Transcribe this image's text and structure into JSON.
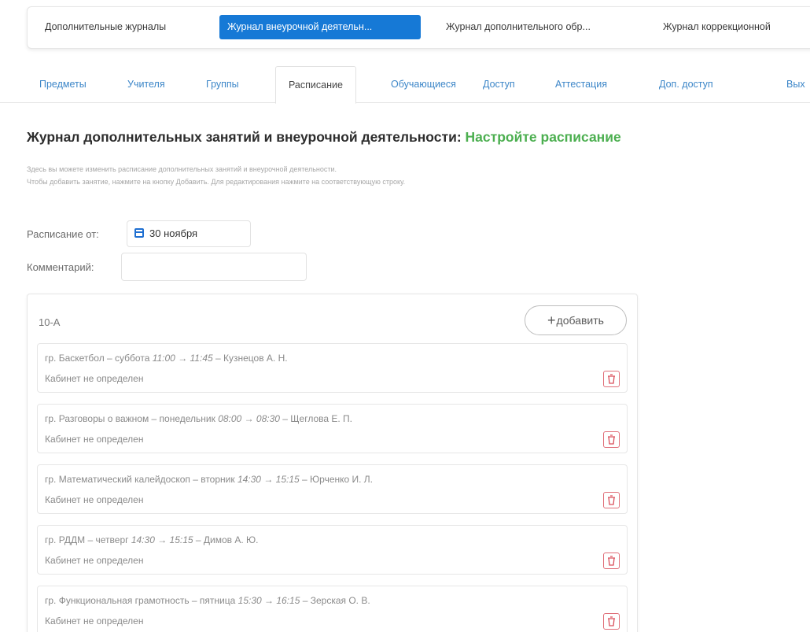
{
  "journals": [
    {
      "label": "Дополнительные журналы",
      "active": false
    },
    {
      "label": "Журнал внеурочной деятельн...",
      "active": true
    },
    {
      "label": "Журнал дополнительного обр...",
      "active": false
    },
    {
      "label": "Журнал коррекционной",
      "active": false
    }
  ],
  "sections": [
    {
      "label": "Предметы",
      "active": false
    },
    {
      "label": "Учителя",
      "active": false
    },
    {
      "label": "Группы",
      "active": false
    },
    {
      "label": "Расписание",
      "active": true
    },
    {
      "label": "Обучающиеся",
      "active": false
    },
    {
      "label": "Доступ",
      "active": false
    },
    {
      "label": "Аттестация",
      "active": false
    },
    {
      "label": "Доп. доступ",
      "active": false
    },
    {
      "label": "Вых",
      "active": false
    }
  ],
  "page": {
    "title": "Журнал дополнительных занятий и внеурочной деятельности:",
    "title_accent": "Настройте расписание",
    "hint_line1": "Здесь вы можете изменить расписание дополнительных занятий и внеурочной деятельности.",
    "hint_line2": "Чтобы добавить занятие, нажмите на кнопку Добавить. Для редактирования нажмите на соответствующую строку."
  },
  "form": {
    "schedule_from_label": "Расписание от:",
    "schedule_date": "30 ноября",
    "comment_label": "Комментарий:",
    "comment_value": "",
    "comment_placeholder": ""
  },
  "group": {
    "name": "10-А",
    "add_label": "добавить",
    "lessons": [
      {
        "prefix": "гр. Баскетбол – суббота ",
        "time": "11:00 → 11:45",
        "teacher": " – Кузнецов А. Н.",
        "room": "Кабинет не определен"
      },
      {
        "prefix": "гр. Разговоры о важном – понедельник ",
        "time": "08:00 → 08:30",
        "teacher": " – Щеглова Е. П.",
        "room": "Кабинет не определен"
      },
      {
        "prefix": "гр. Математический калейдоскоп – вторник ",
        "time": "14:30 → 15:15",
        "teacher": " – Юрченко И. Л.",
        "room": "Кабинет не определен"
      },
      {
        "prefix": "гр. РДДМ – четверг ",
        "time": "14:30 → 15:15",
        "teacher": " – Димов А. Ю.",
        "room": "Кабинет не определен"
      },
      {
        "prefix": "гр. Функциональная грамотность – пятница ",
        "time": "15:30 → 16:15",
        "teacher": " – Зерская О. В.",
        "room": "Кабинет не определен"
      }
    ]
  },
  "colors": {
    "primary": "#1679d6",
    "accent": "#4caf50",
    "link": "#3c86c8",
    "danger": "#e0707a"
  }
}
